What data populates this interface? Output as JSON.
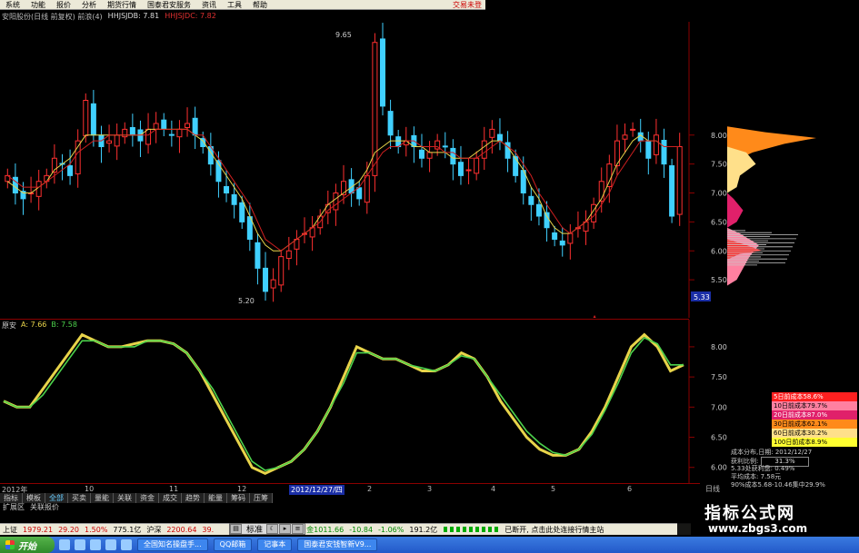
{
  "menu": {
    "items": [
      "系统",
      "功能",
      "报价",
      "分析",
      "期货行情",
      "国泰君安服务",
      "资讯",
      "工具",
      "帮助"
    ],
    "trade": "交易未登"
  },
  "stock": {
    "title": "安阳股份(日线 前复权) 前浪(4)",
    "ma1": "HHJSJDB: 7.81",
    "ma2": "HHJSJDC: 7.82"
  },
  "main_price_axis": [
    "8.00",
    "7.50",
    "7.00",
    "6.50",
    "6.00",
    "5.50"
  ],
  "main_current_price": "5.33",
  "annotations": {
    "high": "9.65",
    "low": "5.20"
  },
  "lower_legend": {
    "name": "原安",
    "a": "A: 7.66",
    "b": "B: 7.58"
  },
  "lower_axis": [
    "8.00",
    "7.50",
    "7.00",
    "6.50",
    "6.00"
  ],
  "date_axis": {
    "labels": [
      "2012年",
      "10",
      "11",
      "12",
      "2",
      "3",
      "4",
      "5",
      "6"
    ],
    "current": "2012/12/27/四",
    "period": "日线"
  },
  "tabs_row1": [
    "指标",
    "模板",
    "全部",
    "买卖",
    "量能",
    "关联",
    "资金",
    "成交",
    "趋势",
    "能量",
    "筹码",
    "压筹"
  ],
  "tabs_row1_active": 2,
  "tabs_row2": [
    "扩展区",
    "关联报价"
  ],
  "cost_legend": [
    {
      "label": "5日前成本58.6%",
      "bg": "#ff2020",
      "fg": "#fff"
    },
    {
      "label": "10日前成本79.7%",
      "bg": "#ff80a0",
      "fg": "#000"
    },
    {
      "label": "20日前成本87.0%",
      "bg": "#e0206a",
      "fg": "#fff"
    },
    {
      "label": "30日前成本62.1%",
      "bg": "#ff8a1a",
      "fg": "#000"
    },
    {
      "label": "60日前成本30.2%",
      "bg": "#ffe08a",
      "fg": "#000"
    },
    {
      "label": "100日前成本8.9%",
      "bg": "#ffff30",
      "fg": "#000"
    }
  ],
  "cost_info": {
    "dist_label": "成本分布,日期:",
    "dist_date": "2012/12/27",
    "profit_label": "获利比例:",
    "profit_value": "31.3%",
    "profit_at_label": "5.33处获利盘:",
    "profit_at_value": "0.49%",
    "avg_label": "平均成本:",
    "avg_value": "7.58元",
    "range_text": "90%成本5.68-10.46集中29.9%"
  },
  "ticker": {
    "sh_label": "上证",
    "sh_value": "1979.21",
    "sh_change": "29.20",
    "sh_pct": "1.50%",
    "sh_amount": "775.1亿",
    "sz_label": "沪深",
    "sz_value": "2200.64",
    "sz_trunc": "39.",
    "zx_value": "金1011.66",
    "zx_change": "-10.84",
    "zx_pct": "-1.06%",
    "zx_amount": "191.2亿",
    "msg": "已断开, 点击此处连接行情主站"
  },
  "std_widget": "标准",
  "taskbar": {
    "start": "开始",
    "tasks": [
      "全国知名操盘手...",
      "QQ邮箱",
      "记事本",
      "国泰君安钱智新V9..."
    ]
  },
  "watermark": {
    "title": "指标公式网",
    "url": "www.zbgs3.com"
  },
  "chart_data": {
    "type": "line",
    "title": "",
    "main": {
      "ylim": [
        5.0,
        9.8
      ],
      "close": [
        7.3,
        7.0,
        6.9,
        7.0,
        7.2,
        7.3,
        7.6,
        7.5,
        7.3,
        7.9,
        8.6,
        8.0,
        7.8,
        7.9,
        8.0,
        8.1,
        8.0,
        7.9,
        8.1,
        8.2,
        8.1,
        8.0,
        8.1,
        8.2,
        8.0,
        7.8,
        7.5,
        7.2,
        7.0,
        6.8,
        6.5,
        6.2,
        5.7,
        5.3,
        5.5,
        5.9,
        6.0,
        6.2,
        6.3,
        6.4,
        6.6,
        6.8,
        7.0,
        7.2,
        7.0,
        6.9,
        7.3,
        9.6,
        8.5,
        8.0,
        7.8,
        7.9,
        7.8,
        7.6,
        7.7,
        7.9,
        7.8,
        7.5,
        7.3,
        7.4,
        7.6,
        7.9,
        8.1,
        7.9,
        7.6,
        7.3,
        7.0,
        6.8,
        6.6,
        6.4,
        6.2,
        6.1,
        6.3,
        6.4,
        6.5,
        6.8,
        7.2,
        7.5,
        7.9,
        8.0,
        8.1,
        7.9,
        7.6,
        8.0,
        7.5,
        6.6,
        7.8
      ],
      "ma1": [
        7.2,
        7.1,
        7.0,
        7.0,
        7.1,
        7.2,
        7.4,
        7.5,
        7.6,
        7.8,
        8.0,
        8.0,
        8.0,
        8.0,
        8.0,
        8.0,
        8.0,
        8.0,
        8.1,
        8.1,
        8.1,
        8.1,
        8.1,
        8.1,
        8.0,
        7.9,
        7.7,
        7.5,
        7.3,
        7.1,
        6.9,
        6.6,
        6.3,
        6.1,
        6.0,
        6.0,
        6.1,
        6.2,
        6.3,
        6.4,
        6.6,
        6.8,
        6.9,
        7.0,
        7.1,
        7.2,
        7.4,
        7.7,
        7.8,
        7.9,
        7.9,
        7.9,
        7.8,
        7.8,
        7.7,
        7.7,
        7.7,
        7.6,
        7.6,
        7.6,
        7.7,
        7.8,
        7.9,
        7.9,
        7.8,
        7.6,
        7.4,
        7.1,
        6.9,
        6.6,
        6.4,
        6.3,
        6.3,
        6.4,
        6.5,
        6.7,
        6.9,
        7.2,
        7.5,
        7.7,
        7.9,
        8.0,
        7.9,
        7.9,
        7.8,
        7.8,
        7.8
      ],
      "ma2": [
        7.3,
        7.2,
        7.1,
        7.1,
        7.1,
        7.2,
        7.3,
        7.4,
        7.5,
        7.7,
        7.8,
        7.9,
        7.9,
        8.0,
        8.0,
        8.0,
        8.0,
        8.0,
        8.0,
        8.1,
        8.1,
        8.1,
        8.1,
        8.1,
        8.0,
        8.0,
        7.8,
        7.6,
        7.4,
        7.2,
        7.0,
        6.8,
        6.5,
        6.2,
        6.1,
        6.0,
        6.1,
        6.2,
        6.3,
        6.4,
        6.5,
        6.7,
        6.8,
        6.9,
        7.0,
        7.1,
        7.3,
        7.5,
        7.7,
        7.8,
        7.8,
        7.9,
        7.9,
        7.8,
        7.8,
        7.8,
        7.7,
        7.7,
        7.6,
        7.6,
        7.6,
        7.7,
        7.8,
        7.9,
        7.8,
        7.7,
        7.5,
        7.3,
        7.0,
        6.8,
        6.6,
        6.4,
        6.3,
        6.4,
        6.5,
        6.6,
        6.8,
        7.0,
        7.3,
        7.5,
        7.7,
        7.9,
        7.9,
        7.9,
        7.8,
        7.8,
        7.8
      ]
    },
    "indicator": {
      "ylim": [
        5.8,
        8.3
      ],
      "series": [
        {
          "name": "A",
          "values": [
            7.1,
            7.0,
            7.0,
            7.3,
            7.6,
            7.9,
            8.2,
            8.1,
            8.0,
            8.0,
            8.05,
            8.1,
            8.1,
            8.05,
            7.9,
            7.6,
            7.2,
            6.8,
            6.4,
            6.0,
            5.9,
            6.0,
            6.1,
            6.3,
            6.6,
            7.0,
            7.5,
            8.0,
            7.9,
            7.8,
            7.8,
            7.7,
            7.6,
            7.6,
            7.7,
            7.9,
            7.8,
            7.5,
            7.1,
            6.8,
            6.5,
            6.3,
            6.2,
            6.2,
            6.3,
            6.6,
            7.0,
            7.5,
            8.0,
            8.2,
            8.0,
            7.6,
            7.7
          ]
        },
        {
          "name": "B",
          "values": [
            7.1,
            7.0,
            7.0,
            7.2,
            7.5,
            7.8,
            8.1,
            8.1,
            8.0,
            8.0,
            8.0,
            8.1,
            8.1,
            8.05,
            7.9,
            7.6,
            7.3,
            6.9,
            6.5,
            6.1,
            5.95,
            6.0,
            6.1,
            6.3,
            6.6,
            7.0,
            7.4,
            7.9,
            7.9,
            7.8,
            7.8,
            7.7,
            7.65,
            7.6,
            7.7,
            7.85,
            7.8,
            7.5,
            7.2,
            6.9,
            6.6,
            6.4,
            6.25,
            6.2,
            6.3,
            6.55,
            6.95,
            7.4,
            7.9,
            8.15,
            8.05,
            7.7,
            7.7
          ]
        }
      ]
    }
  }
}
